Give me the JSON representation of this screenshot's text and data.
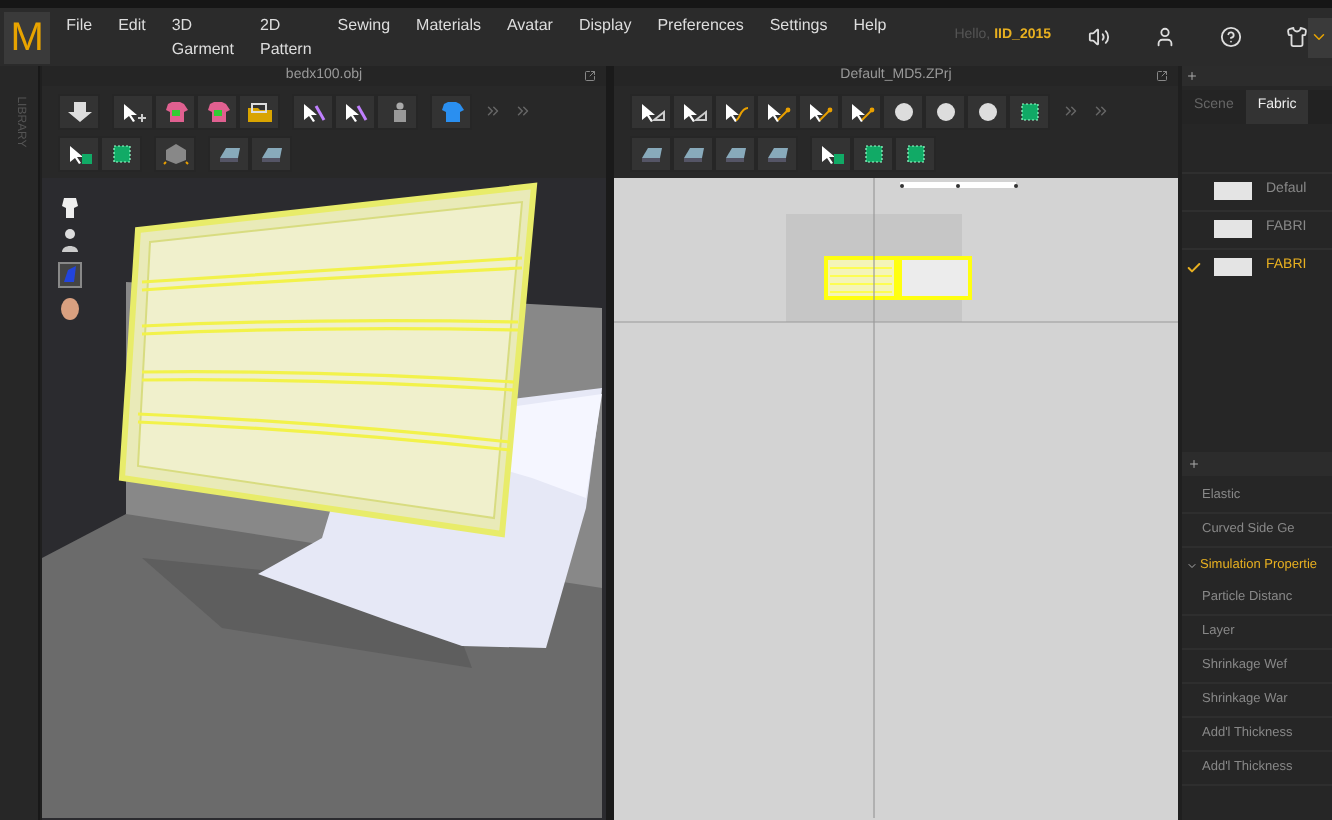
{
  "logo": "M",
  "menu": [
    "File",
    "Edit",
    "3D Garment",
    "2D Pattern",
    "Sewing",
    "Materials",
    "Avatar",
    "Display",
    "Preferences",
    "Settings",
    "Help"
  ],
  "user": {
    "greeting": "Hello,",
    "name": "IID_2015"
  },
  "library_tab": "LIBRARY",
  "panels": {
    "garment_3d": {
      "title": "bedx100.obj"
    },
    "pattern_2d": {
      "title": "Default_MD5.ZPrj"
    }
  },
  "object_browser": {
    "tabs": [
      {
        "label": "Scene",
        "selected": false
      },
      {
        "label": "Fabric",
        "selected": true
      }
    ],
    "fabrics": [
      {
        "name": "Defaul",
        "selected": false
      },
      {
        "name": "FABRI",
        "selected": false
      },
      {
        "name": "FABRI",
        "selected": true
      }
    ]
  },
  "property_editor": {
    "rows": [
      {
        "kind": "item",
        "label": "Elastic"
      },
      {
        "kind": "item",
        "label": "Curved Side Ge"
      },
      {
        "kind": "section",
        "label": "Simulation Propertie",
        "expanded": true
      },
      {
        "kind": "item",
        "label": "Particle Distanc"
      },
      {
        "kind": "item",
        "label": "Layer"
      },
      {
        "kind": "item",
        "label": "Shrinkage Wef"
      },
      {
        "kind": "item",
        "label": "Shrinkage War"
      },
      {
        "kind": "item",
        "label": "Add'l Thickness"
      },
      {
        "kind": "item",
        "label": "Add'l Thickness"
      }
    ]
  }
}
